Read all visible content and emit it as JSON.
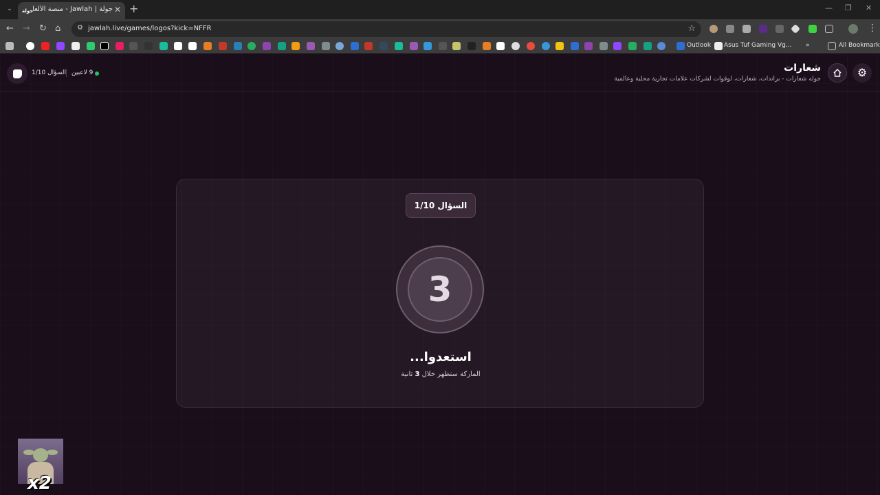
{
  "browser": {
    "tab_title": "جولة | Jawlah - منصة الألعاب الـ",
    "tab_favicon": "جولة",
    "url": "jawlah.live/games/logos?kick=NFFR",
    "bookmarks": {
      "outlook": "Outlook",
      "asus": "Asus Tuf Gaming Vg...",
      "all": "All Bookmarks"
    }
  },
  "header": {
    "title": "شعارات",
    "subtitle": "جوله شعارات - براندات، شعارات، لوقوات لشركات علامات تجارية محلية وعالمية",
    "question_progress": "السؤال 1/10",
    "players": "9 لاعبين"
  },
  "card": {
    "question_badge": "السؤال 1/10",
    "countdown": "3",
    "ready_text": "استعدوا...",
    "ready_sub_before": "الماركة ستظهر خلال ",
    "ready_sub_seconds": "3",
    "ready_sub_after": " ثانية"
  },
  "overlay": {
    "multiplier": "x2"
  },
  "colors": {
    "background": "#1b0e1b",
    "online": "#22c55e"
  }
}
